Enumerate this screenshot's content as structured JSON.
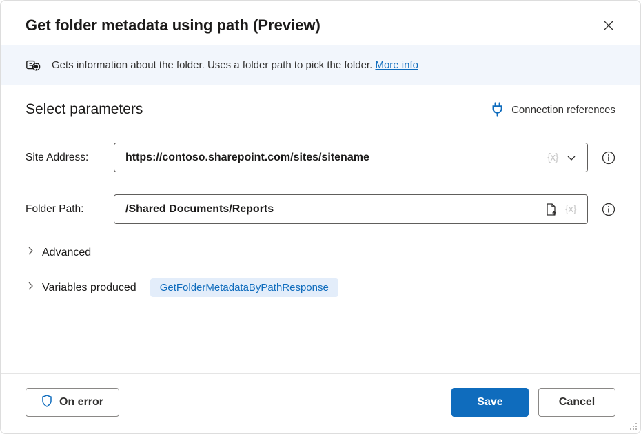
{
  "header": {
    "title": "Get folder metadata using path (Preview)"
  },
  "info": {
    "text": "Gets information about the folder. Uses a folder path to pick the folder. ",
    "link_label": "More info"
  },
  "section": {
    "title": "Select parameters",
    "connection_ref_label": "Connection references"
  },
  "params": {
    "site": {
      "label": "Site Address:",
      "value": "https://contoso.sharepoint.com/sites/sitename"
    },
    "folder": {
      "label": "Folder Path:",
      "value": "/Shared Documents/Reports"
    }
  },
  "advanced_label": "Advanced",
  "variables": {
    "label": "Variables produced",
    "token": "GetFolderMetadataByPathResponse"
  },
  "footer": {
    "on_error": "On error",
    "save": "Save",
    "cancel": "Cancel"
  },
  "inlay_token": "{x}"
}
